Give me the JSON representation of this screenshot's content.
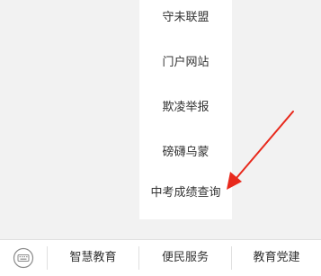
{
  "submenu": {
    "items": [
      {
        "label": "守未联盟"
      },
      {
        "label": "门户网站"
      },
      {
        "label": "欺凌举报"
      },
      {
        "label": "磅礴乌蒙"
      },
      {
        "label": "中考成绩查询"
      }
    ]
  },
  "annotation": {
    "arrow_color": "#e8291c",
    "icon": "red-arrow-icon"
  },
  "bottom_bar": {
    "keyboard_icon": "keyboard-toggle-icon",
    "tabs": [
      {
        "label": "智慧教育"
      },
      {
        "label": "便民服务"
      },
      {
        "label": "教育党建"
      }
    ]
  },
  "colors": {
    "background": "#f2f2f2",
    "menu_background": "#ffffff",
    "text": "#333333",
    "divider": "#e0e0e0"
  }
}
